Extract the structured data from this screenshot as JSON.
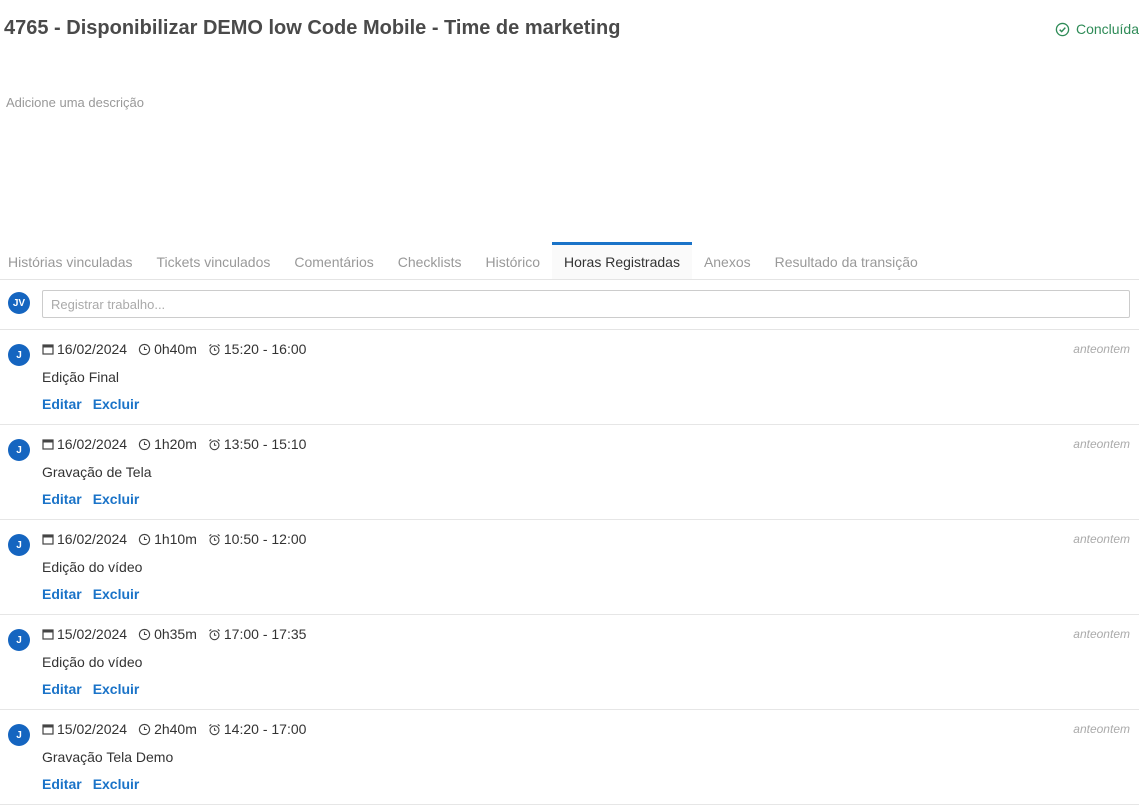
{
  "issue": {
    "title": "4765 - Disponibilizar DEMO low Code Mobile - Time de marketing",
    "status": "Concluída",
    "status_icon": "check-circle-icon",
    "status_color": "#2e8b57",
    "description_placeholder": "Adicione uma descrição"
  },
  "tabs": [
    {
      "label": "Histórias vinculadas",
      "active": false
    },
    {
      "label": "Tickets vinculados",
      "active": false
    },
    {
      "label": "Comentários",
      "active": false
    },
    {
      "label": "Checklists",
      "active": false
    },
    {
      "label": "Histórico",
      "active": false
    },
    {
      "label": "Horas Registradas",
      "active": true
    },
    {
      "label": "Anexos",
      "active": false
    },
    {
      "label": "Resultado da transição",
      "active": false
    }
  ],
  "accent_color": "#1a73c8",
  "log_work": {
    "avatar": "JV",
    "placeholder": "Registrar trabalho..."
  },
  "entries": [
    {
      "avatar": "J",
      "date": "16/02/2024",
      "duration": "0h40m",
      "time_range": "15:20 - 16:00",
      "description": "Edição Final",
      "when": "anteontem",
      "edit_label": "Editar",
      "delete_label": "Excluir"
    },
    {
      "avatar": "J",
      "date": "16/02/2024",
      "duration": "1h20m",
      "time_range": "13:50 - 15:10",
      "description": "Gravação de Tela",
      "when": "anteontem",
      "edit_label": "Editar",
      "delete_label": "Excluir"
    },
    {
      "avatar": "J",
      "date": "16/02/2024",
      "duration": "1h10m",
      "time_range": "10:50 - 12:00",
      "description": "Edição do vídeo",
      "when": "anteontem",
      "edit_label": "Editar",
      "delete_label": "Excluir"
    },
    {
      "avatar": "J",
      "date": "15/02/2024",
      "duration": "0h35m",
      "time_range": "17:00 - 17:35",
      "description": "Edição do vídeo",
      "when": "anteontem",
      "edit_label": "Editar",
      "delete_label": "Excluir"
    },
    {
      "avatar": "J",
      "date": "15/02/2024",
      "duration": "2h40m",
      "time_range": "14:20 - 17:00",
      "description": "Gravação Tela Demo",
      "when": "anteontem",
      "edit_label": "Editar",
      "delete_label": "Excluir"
    }
  ],
  "icons": {
    "date": "calendar-icon",
    "duration": "clock-icon",
    "time_range": "alarm-clock-icon"
  }
}
